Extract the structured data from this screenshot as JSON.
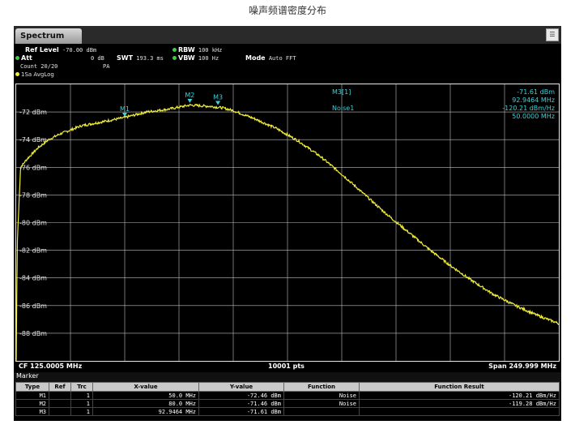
{
  "page_title": "噪声频谱密度分布",
  "window": {
    "tab_label": "Spectrum",
    "menu_icon": "menu-icon"
  },
  "params": {
    "ref_level_label": "Ref Level",
    "ref_level_value": "-70.00 dBm",
    "att_label": "Att",
    "att_value": "0 dB",
    "count_label": "Count",
    "count_value": "20/20",
    "swt_label": "SWT",
    "swt_value": "193.3 ms",
    "rbw_label": "RBW",
    "rbw_value": "100 kHz",
    "vbw_label": "VBW",
    "vbw_value": "100 Hz",
    "mode_label": "Mode",
    "mode_value": "Auto FFT",
    "pa": "PA",
    "trace_label": "1Sa AvgLog"
  },
  "marker_readout": {
    "m3_label": "M3[1]",
    "m3_level": "-71.61 dBm",
    "m3_freq": "92.9464 MHz",
    "noise_label": "Noise1",
    "noise_value": "-120.21 dBm/Hz",
    "noise_freq": "50.0000 MHz"
  },
  "status": {
    "cf": "CF 125.0005 MHz",
    "pts": "10001 pts",
    "span": "Span 249.999 MHz"
  },
  "marker_table": {
    "title": "Marker",
    "headers": [
      "Type",
      "Ref",
      "Trc",
      "X-value",
      "Y-value",
      "Function",
      "Function Result"
    ],
    "rows": [
      [
        "M1",
        "",
        "1",
        "50.0 MHz",
        "-72.46 dBm",
        "Noise",
        "-120.21 dBm/Hz"
      ],
      [
        "M2",
        "",
        "1",
        "80.0 MHz",
        "-71.46 dBm",
        "Noise",
        "-119.28 dBm/Hz"
      ],
      [
        "M3",
        "",
        "1",
        "92.9464 MHz",
        "-71.61 dBm",
        "",
        ""
      ]
    ]
  },
  "colors": {
    "trace": "#f2ee3a",
    "marker": "#3fd0d8",
    "grid": "#bfbfbf",
    "readout": "#3fd0d8"
  },
  "chart_data": {
    "type": "line",
    "x_unit": "MHz",
    "y_unit": "dBm",
    "xlim": [
      0.001,
      250.0
    ],
    "ylim": [
      -90,
      -70
    ],
    "yticks": [
      "-72 dBm",
      "-74 dBm",
      "-76 dBm",
      "-78 dBm",
      "-80 dBm",
      "-82 dBm",
      "-84 dBm",
      "-86 dBm",
      "-88 dBm"
    ],
    "ytick_values": [
      -72,
      -74,
      -76,
      -78,
      -80,
      -82,
      -84,
      -86,
      -88
    ],
    "x": [
      0.5,
      2,
      5,
      10,
      15,
      20,
      25,
      30,
      40,
      50,
      60,
      70,
      80,
      90,
      95,
      100,
      110,
      120,
      130,
      140,
      150,
      160,
      170,
      180,
      190,
      200,
      210,
      220,
      230,
      240,
      250
    ],
    "y": [
      -81.5,
      -76.0,
      -75.4,
      -74.6,
      -74.0,
      -73.6,
      -73.3,
      -73.0,
      -72.7,
      -72.4,
      -72.0,
      -71.8,
      -71.5,
      -71.6,
      -71.7,
      -71.9,
      -72.5,
      -73.2,
      -74.1,
      -75.2,
      -76.5,
      -77.9,
      -79.3,
      -80.6,
      -81.9,
      -83.1,
      -84.2,
      -85.2,
      -86.0,
      -86.7,
      -87.3
    ],
    "markers": [
      {
        "name": "M1",
        "x": 50.0,
        "y": -72.46
      },
      {
        "name": "M2",
        "x": 80.0,
        "y": -71.46
      },
      {
        "name": "M3",
        "x": 92.9464,
        "y": -71.61
      }
    ]
  }
}
